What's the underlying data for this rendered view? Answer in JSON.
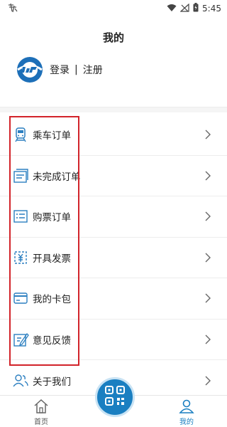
{
  "status_bar": {
    "time": "5:45"
  },
  "header": {
    "title": "我的"
  },
  "profile": {
    "login": "登录",
    "separator": "|",
    "register": "注册"
  },
  "menu": {
    "items": [
      {
        "label": "乘车订单",
        "icon": "train-icon"
      },
      {
        "label": "未完成订单",
        "icon": "clipboard-icon"
      },
      {
        "label": "购票订单",
        "icon": "ticket-list-icon"
      },
      {
        "label": "开具发票",
        "icon": "invoice-icon"
      },
      {
        "label": "我的卡包",
        "icon": "card-icon"
      },
      {
        "label": "意见反馈",
        "icon": "feedback-icon"
      },
      {
        "label": "关于我们",
        "icon": "people-icon"
      }
    ]
  },
  "tabbar": {
    "home": "首页",
    "mine": "我的"
  },
  "colors": {
    "accent": "#1a7fc1",
    "highlight": "#d2232a"
  }
}
